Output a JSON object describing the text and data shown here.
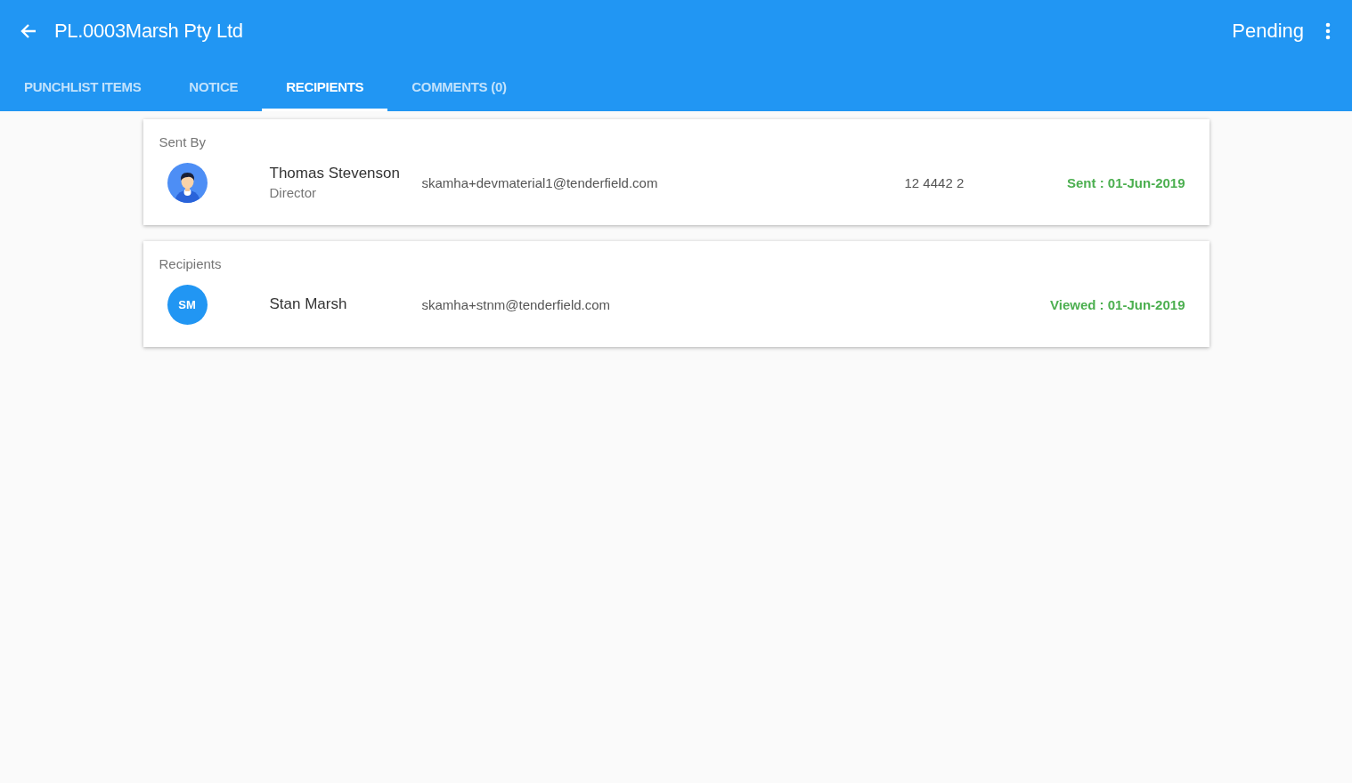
{
  "header": {
    "title": "PL.0003Marsh Pty Ltd",
    "status": "Pending"
  },
  "tabs": [
    {
      "label": "PUNCHLIST ITEMS",
      "selected": false
    },
    {
      "label": "NOTICE",
      "selected": false
    },
    {
      "label": "RECIPIENTS",
      "selected": true
    },
    {
      "label": "COMMENTS (0)",
      "selected": false
    }
  ],
  "sections": [
    {
      "title": "Sent By",
      "people": [
        {
          "avatar": {
            "kind": "illustration"
          },
          "name": "Thomas Stevenson",
          "role": "Director",
          "email": "skamha+devmaterial1@tenderfield.com",
          "phone": "12 4442 2",
          "status": "Sent : 01-Jun-2019"
        }
      ]
    },
    {
      "title": "Recipients",
      "people": [
        {
          "avatar": {
            "kind": "initials",
            "text": "SM"
          },
          "name": "Stan Marsh",
          "email": "skamha+stnm@tenderfield.com",
          "status": "Viewed : 01-Jun-2019"
        }
      ]
    }
  ]
}
